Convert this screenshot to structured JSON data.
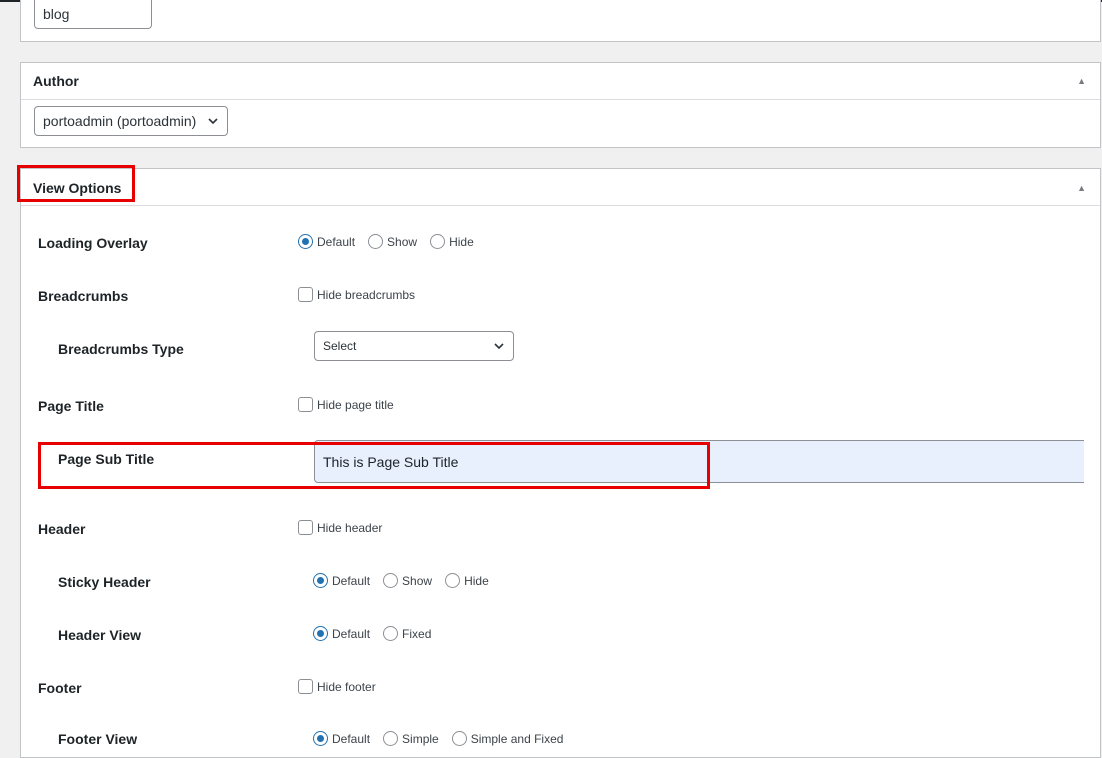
{
  "slug": {
    "value": "blog"
  },
  "author_panel": {
    "title": "Author",
    "selected": "portoadmin (portoadmin)"
  },
  "view_options": {
    "title": "View Options",
    "loading_overlay": {
      "label": "Loading Overlay",
      "options": [
        "Default",
        "Show",
        "Hide"
      ],
      "selected": "Default"
    },
    "breadcrumbs": {
      "label": "Breadcrumbs",
      "checkbox": "Hide breadcrumbs",
      "checked": false
    },
    "breadcrumbs_type": {
      "label": "Breadcrumbs Type",
      "selected": "Select"
    },
    "page_title": {
      "label": "Page Title",
      "checkbox": "Hide page title",
      "checked": false
    },
    "page_sub_title": {
      "label": "Page Sub Title",
      "value": "This is Page Sub Title"
    },
    "header": {
      "label": "Header",
      "checkbox": "Hide header",
      "checked": false
    },
    "sticky_header": {
      "label": "Sticky Header",
      "options": [
        "Default",
        "Show",
        "Hide"
      ],
      "selected": "Default"
    },
    "header_view": {
      "label": "Header View",
      "options": [
        "Default",
        "Fixed"
      ],
      "selected": "Default"
    },
    "footer": {
      "label": "Footer",
      "checkbox": "Hide footer",
      "checked": false
    },
    "footer_view": {
      "label": "Footer View",
      "options": [
        "Default",
        "Simple",
        "Simple and Fixed"
      ],
      "selected": "Default"
    }
  },
  "colors": {
    "accent": "#2271b1",
    "highlight": "#e60000",
    "autofill": "#e8f0fe"
  },
  "icons": {
    "collapse": "triangle-up-icon",
    "dropdown": "chevron-down-icon"
  }
}
